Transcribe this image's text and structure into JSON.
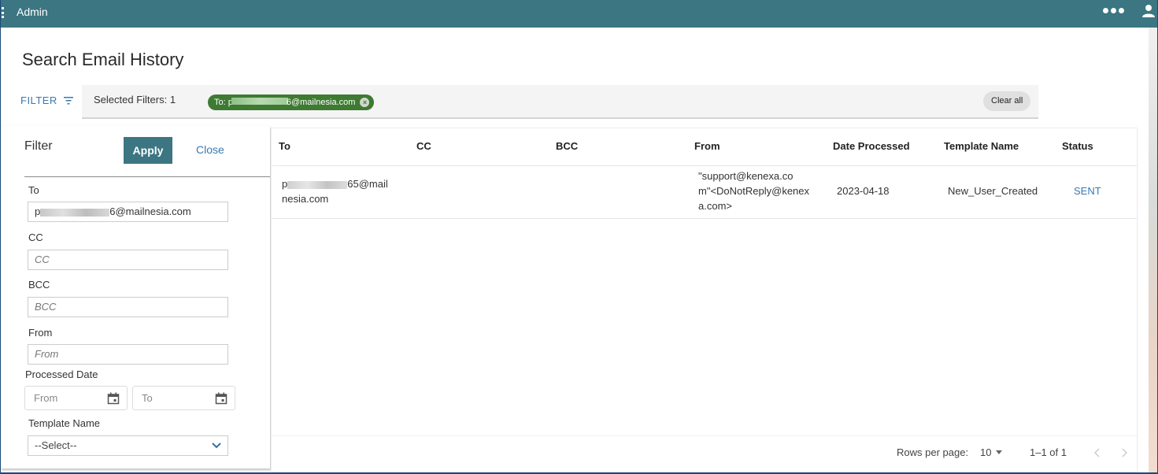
{
  "app": {
    "title": "Admin",
    "icons": {
      "menu": "vertical-dots-icon",
      "more": "more-horizontal-icon",
      "user": "user-icon"
    }
  },
  "page": {
    "title": "Search Email History"
  },
  "filter_bar": {
    "toggle_label": "FILTER",
    "selected_label": "Selected Filters: 1",
    "chip": {
      "prefix": "To: p",
      "suffix": "6@mailnesia.com"
    },
    "clear_all_label": "Clear all"
  },
  "filter_panel": {
    "title": "Filter",
    "apply_label": "Apply",
    "close_label": "Close",
    "fields": {
      "to": {
        "label": "To",
        "value_prefix": "p",
        "value_suffix": "6@mailnesia.com"
      },
      "cc": {
        "label": "CC",
        "placeholder": "CC"
      },
      "bcc": {
        "label": "BCC",
        "placeholder": "BCC"
      },
      "from": {
        "label": "From",
        "placeholder": "From"
      },
      "processed_date": {
        "label": "Processed Date",
        "from_placeholder": "From",
        "to_placeholder": "To"
      },
      "template_name": {
        "label": "Template Name",
        "selected": "--Select--"
      }
    }
  },
  "table": {
    "columns": [
      "To",
      "CC",
      "BCC",
      "From",
      "Date Processed",
      "Template Name",
      "Status"
    ],
    "rows": [
      {
        "to_prefix": "p",
        "to_line1_suffix": "65@mail",
        "to_line2": "nesia.com",
        "cc": "",
        "bcc": "",
        "from_lines": [
          "\"support@kenexa.co",
          "m\"<DoNotReply@kenex",
          "a.com>"
        ],
        "date_processed": "2023-04-18",
        "template_name": "New_User_Created",
        "status": "SENT"
      }
    ],
    "pagination": {
      "rows_per_page_label": "Rows per page:",
      "rows_per_page": "10",
      "range": "1–1 of 1"
    }
  },
  "colors": {
    "topbar": "#3b7682",
    "apply_button": "#3b7682",
    "chip": "#3e7a32",
    "link": "#3a78b0"
  }
}
